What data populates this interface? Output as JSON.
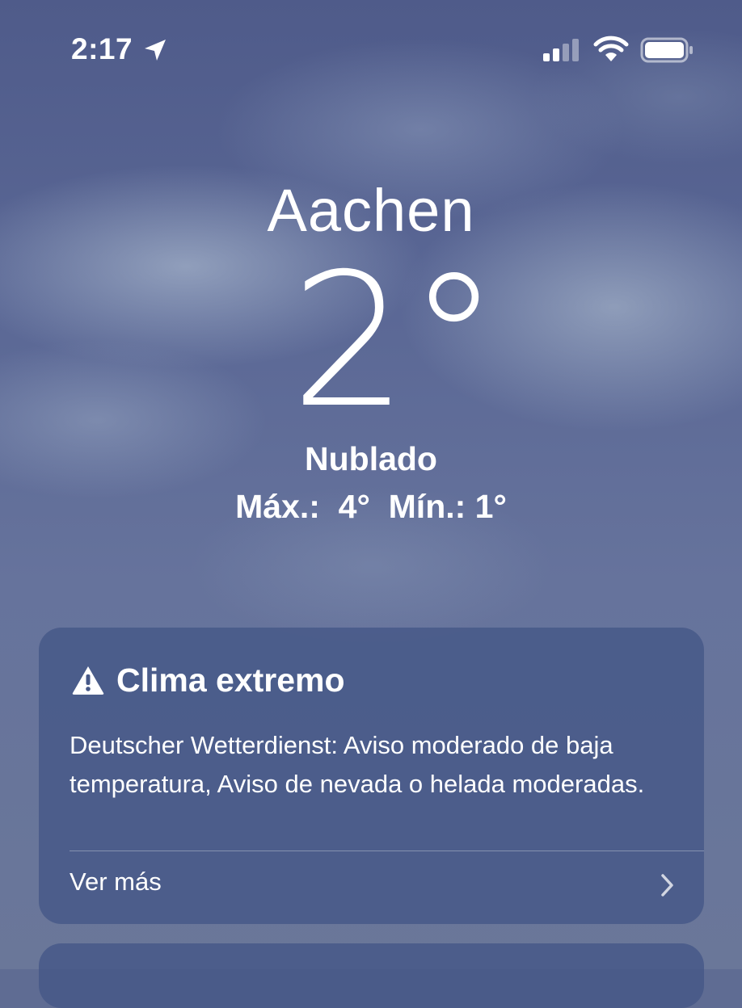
{
  "status_bar": {
    "time": "2:17",
    "location_icon": "location-arrow-icon",
    "signal_icon": "cellular-signal-icon",
    "wifi_icon": "wifi-icon",
    "battery_icon": "battery-icon"
  },
  "weather": {
    "city": "Aachen",
    "temperature": "2°",
    "condition": "Nublado",
    "high_low": "Máx.:  4°  Mín.: 1°"
  },
  "alert": {
    "icon": "warning-icon",
    "title": "Clima extremo",
    "body": "Deutscher Wetterdienst: Aviso moderado de baja temperatura, Aviso de nevada o helada moderadas.",
    "see_more": "Ver más",
    "chevron_icon": "chevron-right-icon"
  },
  "colors": {
    "sky_top": "#4f5b8a",
    "sky_bottom": "#6a7799",
    "card_background": "#465888",
    "text": "#ffffff"
  }
}
